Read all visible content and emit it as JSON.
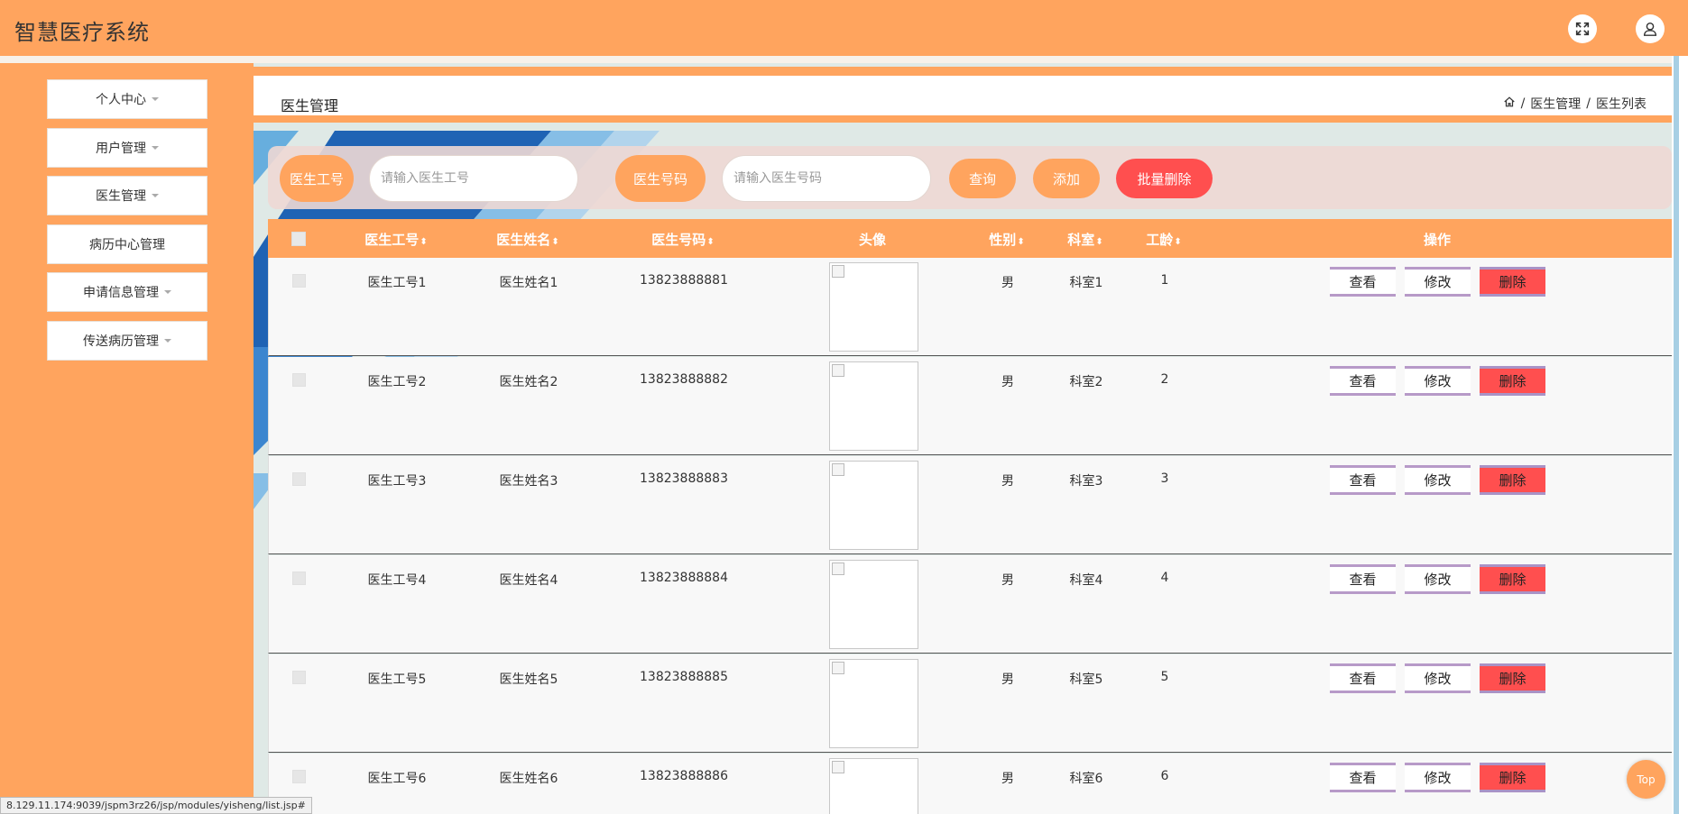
{
  "app": {
    "title": "智慧医疗系统"
  },
  "header_icons": [
    "fullscreen-icon",
    "user-icon"
  ],
  "sidebar": {
    "items": [
      {
        "label": "个人中心",
        "has_caret": true
      },
      {
        "label": "用户管理",
        "has_caret": true
      },
      {
        "label": "医生管理",
        "has_caret": true
      },
      {
        "label": "病历中心管理",
        "has_caret": false
      },
      {
        "label": "申请信息管理",
        "has_caret": true
      },
      {
        "label": "传送病历管理",
        "has_caret": true
      }
    ]
  },
  "page": {
    "title": "医生管理",
    "breadcrumb": [
      "医生管理",
      "医生列表"
    ]
  },
  "search": {
    "field1_label": "医生工号",
    "field1_placeholder": "请输入医生工号",
    "field2_label": "医生号码",
    "field2_placeholder": "请输入医生号码",
    "query_label": "查询",
    "add_label": "添加",
    "batch_delete_label": "批量删除"
  },
  "table": {
    "headers": {
      "id": "医生工号",
      "name": "医生姓名",
      "phone": "医生号码",
      "avatar": "头像",
      "gender": "性别",
      "dept": "科室",
      "years": "工龄",
      "actions": "操作"
    },
    "sort_glyph": "⬍",
    "action_labels": {
      "view": "查看",
      "edit": "修改",
      "delete": "删除"
    },
    "rows": [
      {
        "id": "医生工号1",
        "name": "医生姓名1",
        "phone": "13823888881",
        "gender": "男",
        "dept": "科室1",
        "years": "1"
      },
      {
        "id": "医生工号2",
        "name": "医生姓名2",
        "phone": "13823888882",
        "gender": "男",
        "dept": "科室2",
        "years": "2"
      },
      {
        "id": "医生工号3",
        "name": "医生姓名3",
        "phone": "13823888883",
        "gender": "男",
        "dept": "科室3",
        "years": "3"
      },
      {
        "id": "医生工号4",
        "name": "医生姓名4",
        "phone": "13823888884",
        "gender": "男",
        "dept": "科室4",
        "years": "4"
      },
      {
        "id": "医生工号5",
        "name": "医生姓名5",
        "phone": "13823888885",
        "gender": "男",
        "dept": "科室5",
        "years": "5"
      },
      {
        "id": "医生工号6",
        "name": "医生姓名6",
        "phone": "13823888886",
        "gender": "男",
        "dept": "科室6",
        "years": "6"
      }
    ]
  },
  "back_to_top": "Top",
  "status_url": "8.129.11.174:9039/jspm3rz26/jsp/modules/yisheng/list.jsp#",
  "colors": {
    "primary": "#ffa45e",
    "danger": "#ff4f4f",
    "action_border": "#b79ac8"
  }
}
